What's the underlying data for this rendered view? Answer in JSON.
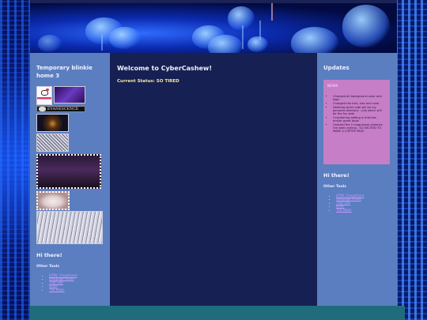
{
  "left": {
    "title": "Temporary blinkie home 3",
    "blinkie_label": "EVANESCENCE",
    "hi_heading": "Hi there!",
    "other_heading": "Other Tools",
    "links": [
      "HTML Cheatsheet",
      "Webpage Guide",
      "That Site",
      "Links",
      "The News"
    ]
  },
  "main": {
    "title": "Welcome to CyberCashew!",
    "status": "Current Status: SO TIRED"
  },
  "right": {
    "title": "Updates",
    "news_title": "NEWS",
    "news_items": [
      "Changed all background color and logo",
      "Changed the font, size and color",
      "Deleting which side will be my personal directory - just which will be the fun side",
      "Considering adding a chat box and/or guest book",
      "Ordered the 2 magnesses sheenes I've been eyeing - SO EXCITED TO MAKE A COFFEE PAGE"
    ],
    "hi_heading": "Hi there!",
    "other_heading": "Other Tools",
    "links": [
      "HTML Cheatsheet",
      "Webpage Guide",
      "That Site",
      "Links",
      "The News"
    ]
  }
}
